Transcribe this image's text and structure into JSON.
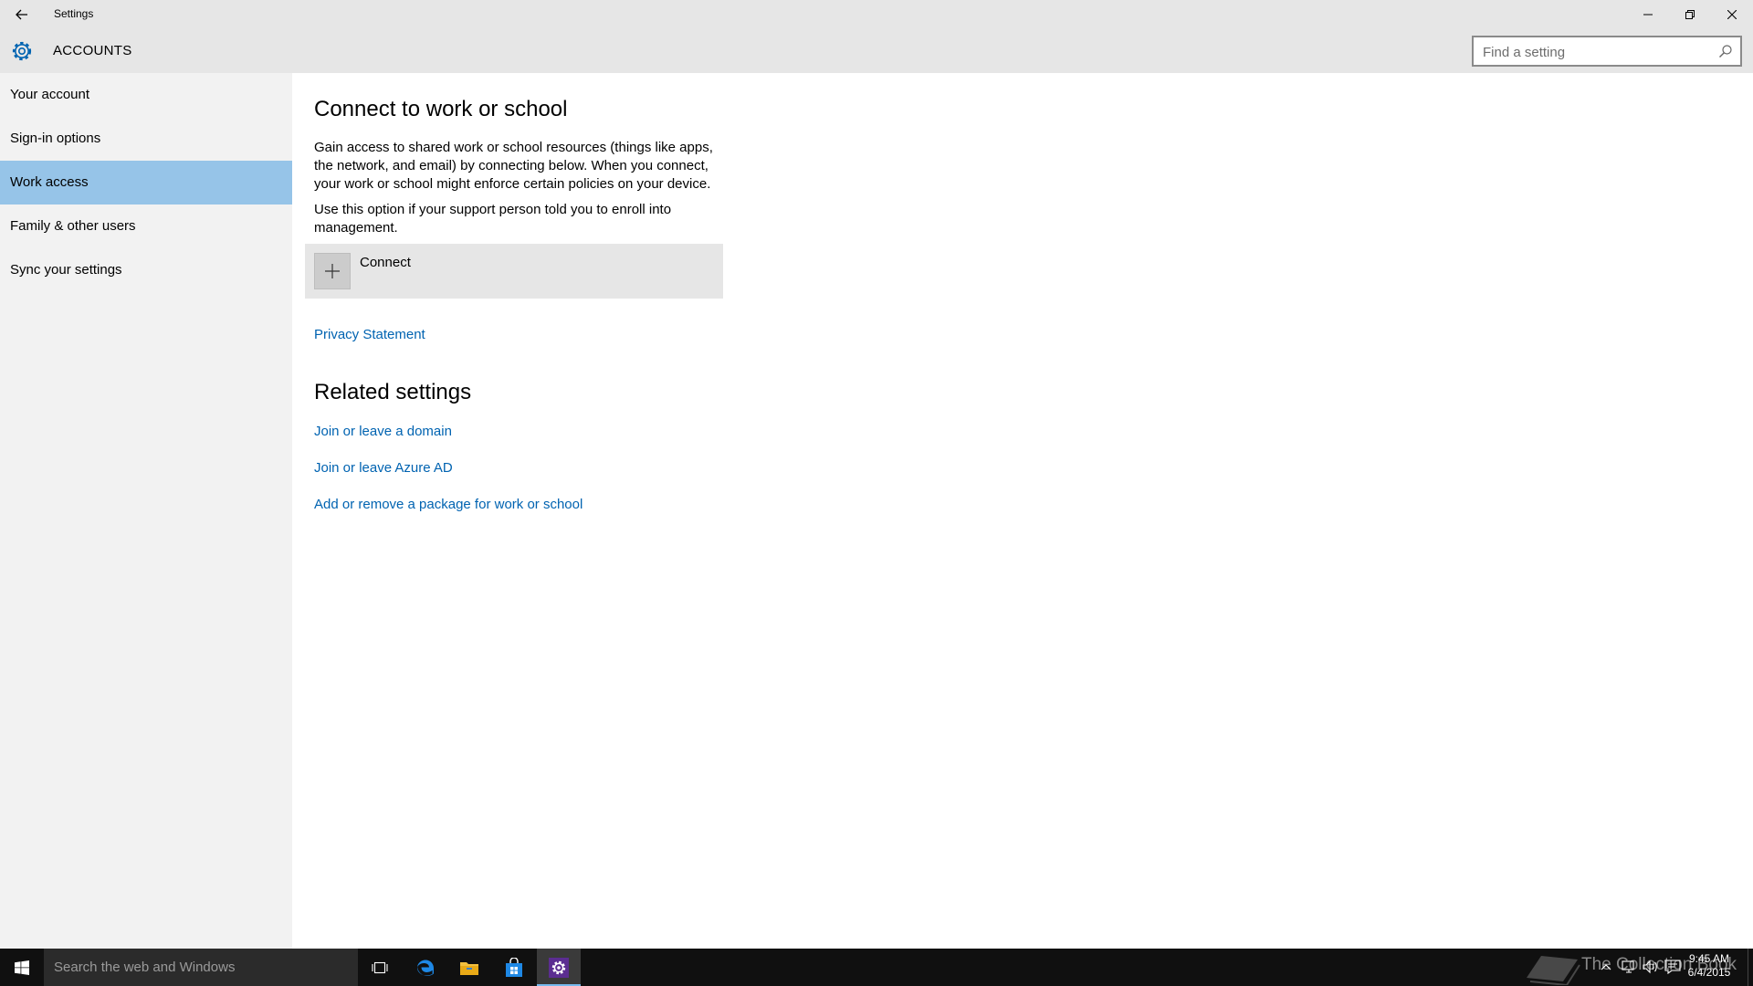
{
  "window": {
    "title": "Settings",
    "controls": {
      "minimize": "—",
      "maximize": "❐",
      "close": "✕"
    }
  },
  "header": {
    "title": "ACCOUNTS",
    "icon": "gear-icon",
    "accent_color": "#0063b1"
  },
  "search": {
    "placeholder": "Find a setting",
    "icon": "search-icon"
  },
  "sidebar": {
    "items": [
      {
        "label": "Your account",
        "active": false
      },
      {
        "label": "Sign-in options",
        "active": false
      },
      {
        "label": "Work access",
        "active": true
      },
      {
        "label": "Family & other users",
        "active": false
      },
      {
        "label": "Sync your settings",
        "active": false
      }
    ],
    "active_color": "#96c4e8"
  },
  "main": {
    "heading": "Connect to work or school",
    "description": "Gain access to shared work or school resources (things like apps, the network, and email) by connecting below. When you connect, your work or school might enforce certain policies on your device.",
    "enroll_note": "Use this option if your support person told you to enroll into management.",
    "connect_label": "Connect",
    "privacy_link": "Privacy Statement",
    "related_heading": "Related settings",
    "related_links": [
      "Join or leave a domain",
      "Join or leave Azure AD",
      "Add or remove a package for work or school"
    ],
    "link_color": "#0063b1"
  },
  "taskbar": {
    "search_placeholder": "Search the web and Windows",
    "pinned": [
      "task-view-icon",
      "edge-icon",
      "file-explorer-icon",
      "store-icon",
      "settings-icon"
    ],
    "watermark_text": "The Collection Book",
    "clock": {
      "time": "9:45 AM",
      "date": "6/4/2015"
    }
  }
}
